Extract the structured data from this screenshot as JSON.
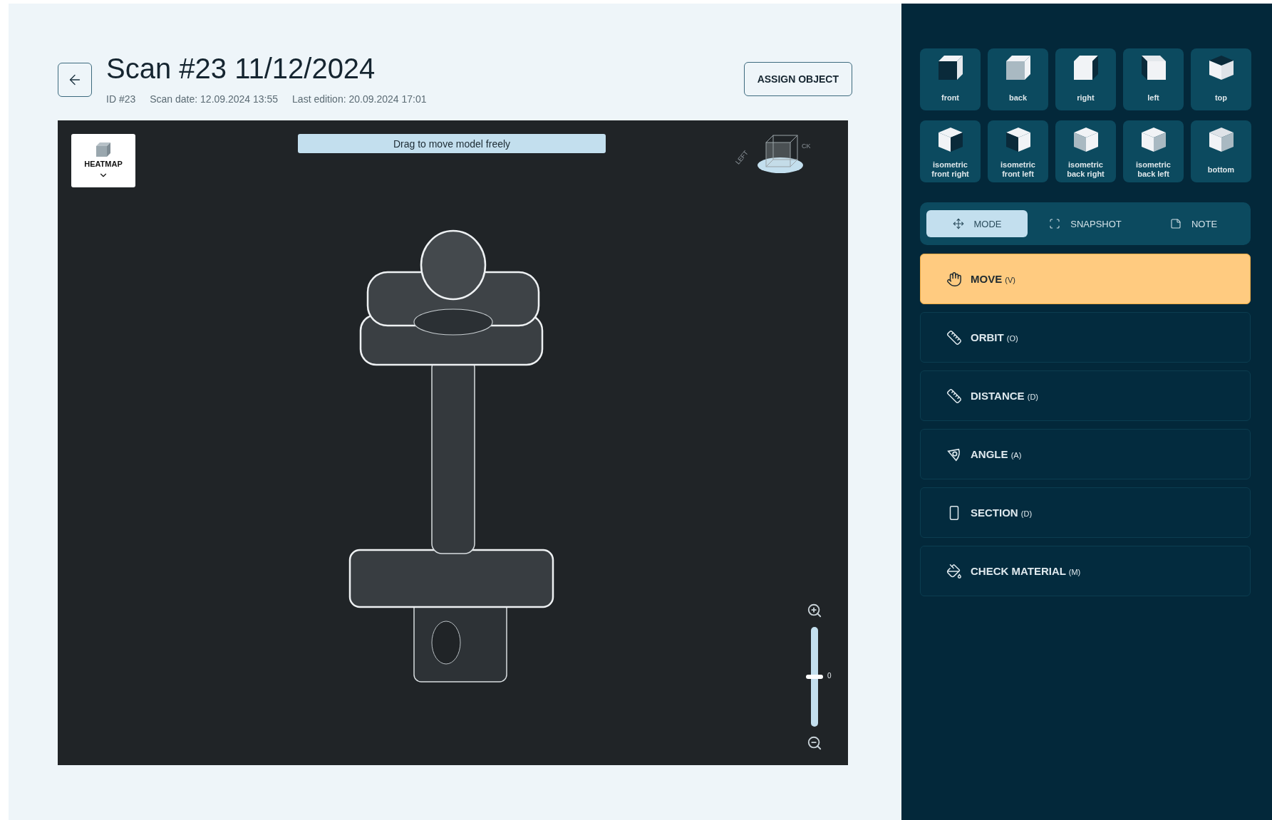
{
  "header": {
    "title": "Scan #23 11/12/2024",
    "meta": [
      "ID #23",
      "Scan date: 12.09.2024 13:55",
      "Last edition: 20.09.2024 17:01"
    ],
    "assign_button": "ASSIGN OBJECT"
  },
  "viewport": {
    "heatmap": {
      "label": "HEATMAP",
      "expanded": false
    },
    "hint": "Drag to move model freely",
    "gizmo": {
      "labels": [
        "LEFT",
        "CK"
      ]
    },
    "zoom": {
      "level": 0.5,
      "reading": "0"
    }
  },
  "views": [
    {
      "label": "front",
      "kind": "front"
    },
    {
      "label": "back",
      "kind": "back"
    },
    {
      "label": "right",
      "kind": "right"
    },
    {
      "label": "left",
      "kind": "left"
    },
    {
      "label": "top",
      "kind": "top"
    },
    {
      "label": "isometric front right",
      "kind": "iso_front_right"
    },
    {
      "label": "isometric front left",
      "kind": "iso_front_left"
    },
    {
      "label": "isometric back right",
      "kind": "iso_back_right"
    },
    {
      "label": "isometric back left",
      "kind": "iso_back_left"
    },
    {
      "label": "bottom",
      "kind": "bottom"
    }
  ],
  "mode_tabs": [
    {
      "label": "MODE",
      "kind": "move",
      "selected": true
    },
    {
      "label": "SNAPSHOT",
      "kind": "snapshot",
      "selected": false
    },
    {
      "label": "NOTE",
      "kind": "note",
      "selected": false
    }
  ],
  "tools": [
    {
      "label": "MOVE",
      "shortcut": "(V)",
      "kind": "hand",
      "selected": true
    },
    {
      "label": "ORBIT",
      "shortcut": "(O)",
      "kind": "ruler",
      "selected": false
    },
    {
      "label": "DISTANCE",
      "shortcut": "(D)",
      "kind": "ruler",
      "selected": false
    },
    {
      "label": "ANGLE",
      "shortcut": "(A)",
      "kind": "angle",
      "selected": false
    },
    {
      "label": "SECTION",
      "shortcut": "(D)",
      "kind": "section",
      "selected": false
    },
    {
      "label": "CHECK MATERIAL",
      "shortcut": "(M)",
      "kind": "bucket",
      "selected": false
    }
  ]
}
